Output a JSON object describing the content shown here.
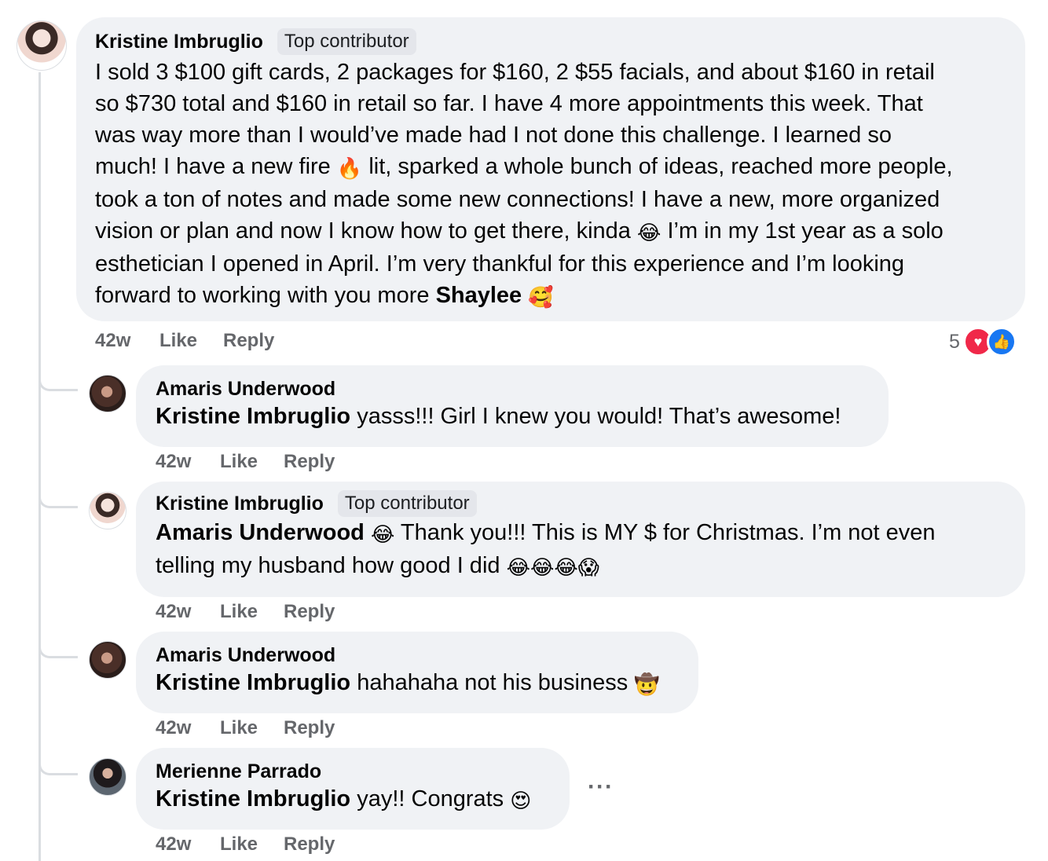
{
  "comments": [
    {
      "author": "Kristine Imbruglio",
      "badge": "Top contributor",
      "line1": "I sold 3 $100 gift cards, 2 packages for $160, 2 $55 facials, and about $160 in retail",
      "line2": "so $730 total and $160 in retail so far. I have 4 more appointments this week. That",
      "line3": "was way more than I would’ve made had I not done this challenge. I learned so",
      "line4a": "much! I have a new fire",
      "emoji_fire": "🔥",
      "line4b": "lit, sparked a whole bunch of ideas, reached more people,",
      "line5": "took a ton of notes and made some new connections! I have a new, more organized",
      "line6a": "vision or plan and now I know how to get there, kinda",
      "emoji_laugh": "😂",
      "line6b": "I’m in my 1st year as a solo",
      "line7": "esthetician I opened in April. I’m very thankful for this experience and I’m looking",
      "line8a": "forward to working with you more",
      "mention": "Shaylee",
      "emoji_hearts": "🥰",
      "time": "42w",
      "like": "Like",
      "reply": "Reply",
      "reaction_count": "5",
      "reaction_love": "♥",
      "reaction_like": "👍"
    },
    {
      "author": "Amaris Underwood",
      "mention": "Kristine Imbruglio",
      "text": "yasss!!! Girl I knew you would! That’s awesome!",
      "time": "42w",
      "like": "Like",
      "reply": "Reply"
    },
    {
      "author": "Kristine Imbruglio",
      "badge": "Top contributor",
      "mention": "Amaris Underwood",
      "emoji1": "😂",
      "text_a": "Thank you!!! This is MY $ for Christmas. I’m not even",
      "text_b": "telling my husband how good I did",
      "emoji_tail": "😂😂😂😱",
      "time": "42w",
      "like": "Like",
      "reply": "Reply"
    },
    {
      "author": "Amaris Underwood",
      "mention": "Kristine Imbruglio",
      "text": "hahahaha not his business",
      "emoji": "🤠",
      "time": "42w",
      "like": "Like",
      "reply": "Reply"
    },
    {
      "author": "Merienne Parrado",
      "mention": "Kristine Imbruglio",
      "text": "yay!! Congrats",
      "emoji": "😍",
      "time": "42w",
      "like": "Like",
      "reply": "Reply",
      "more": "···"
    }
  ],
  "icons": {
    "more_icon": "more-horizontal-icon",
    "love_icon": "love-reaction-icon",
    "like_icon": "like-reaction-icon"
  },
  "colors": {
    "bubble": "#f0f2f5",
    "meta": "#65676b",
    "love": "#f02849",
    "like": "#1877f2"
  }
}
